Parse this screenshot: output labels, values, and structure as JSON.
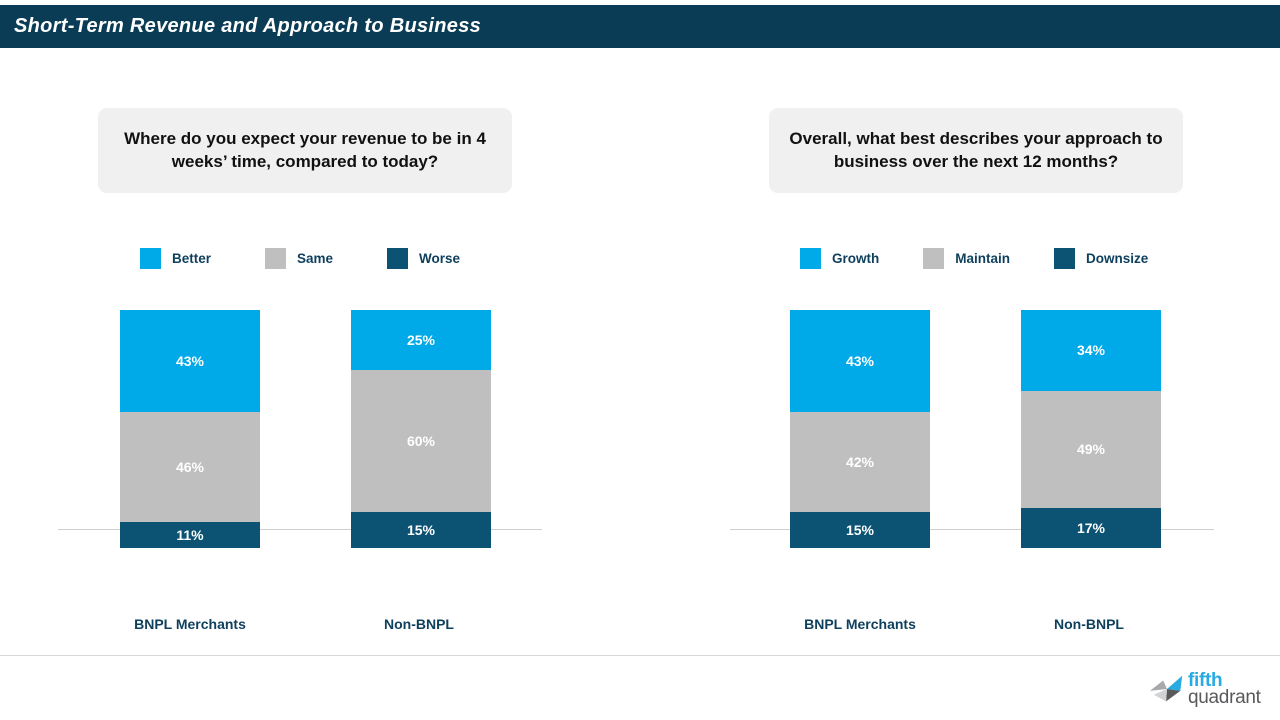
{
  "header": {
    "title": "Short-Term Revenue and Approach to Business"
  },
  "colors": {
    "header_bar": "#0a3d55",
    "accent_light_blue": "#00a9e8",
    "accent_gray": "#bfbfbf",
    "accent_dark_blue": "#0b5273",
    "question_box_bg": "#f0f0f0",
    "label_text": "#0e3f5c",
    "axis_line": "#cfcfcf"
  },
  "panels": [
    {
      "question": "Where do you expect your revenue to be in 4 weeks’ time, compared to today?",
      "legend": [
        {
          "label": "Better",
          "color": "#00a9e8"
        },
        {
          "label": "Same",
          "color": "#bfbfbf"
        },
        {
          "label": "Worse",
          "color": "#0b5273"
        }
      ]
    },
    {
      "question": "Overall, what best describes your approach to business over the next 12 months?",
      "legend": [
        {
          "label": "Growth",
          "color": "#00a9e8"
        },
        {
          "label": "Maintain",
          "color": "#bfbfbf"
        },
        {
          "label": "Downsize",
          "color": "#0b5273"
        }
      ]
    }
  ],
  "footer": {
    "logo_primary": "fifth",
    "logo_secondary": "quadrant"
  },
  "chart_data": [
    {
      "type": "bar",
      "subtype": "stacked-100",
      "title": "Where do you expect your revenue to be in 4 weeks’ time, compared to today?",
      "xlabel": "",
      "ylabel": "",
      "ylim": [
        0,
        100
      ],
      "grid": false,
      "legend_position": "top-left",
      "categories": [
        "BNPL Merchants",
        "Non-BNPL"
      ],
      "series": [
        {
          "name": "Better",
          "color": "#00a9e8",
          "values": [
            43,
            25
          ],
          "labels": [
            "43%",
            "25%"
          ]
        },
        {
          "name": "Same",
          "color": "#bfbfbf",
          "values": [
            46,
            60
          ],
          "labels": [
            "46%",
            "60%"
          ]
        },
        {
          "name": "Worse",
          "color": "#0b5273",
          "values": [
            11,
            15
          ],
          "labels": [
            "11%",
            "15%"
          ]
        }
      ]
    },
    {
      "type": "bar",
      "subtype": "stacked-100",
      "title": "Overall, what best describes your approach to business over the next 12 months?",
      "xlabel": "",
      "ylabel": "",
      "ylim": [
        0,
        100
      ],
      "grid": false,
      "legend_position": "top-left",
      "categories": [
        "BNPL Merchants",
        "Non-BNPL"
      ],
      "series": [
        {
          "name": "Growth",
          "color": "#00a9e8",
          "values": [
            43,
            34
          ],
          "labels": [
            "43%",
            "34%"
          ]
        },
        {
          "name": "Maintain",
          "color": "#bfbfbf",
          "values": [
            42,
            49
          ],
          "labels": [
            "42%",
            "49%"
          ]
        },
        {
          "name": "Downsize",
          "color": "#0b5273",
          "values": [
            15,
            17
          ],
          "labels": [
            "15%",
            "17%"
          ]
        }
      ]
    }
  ]
}
